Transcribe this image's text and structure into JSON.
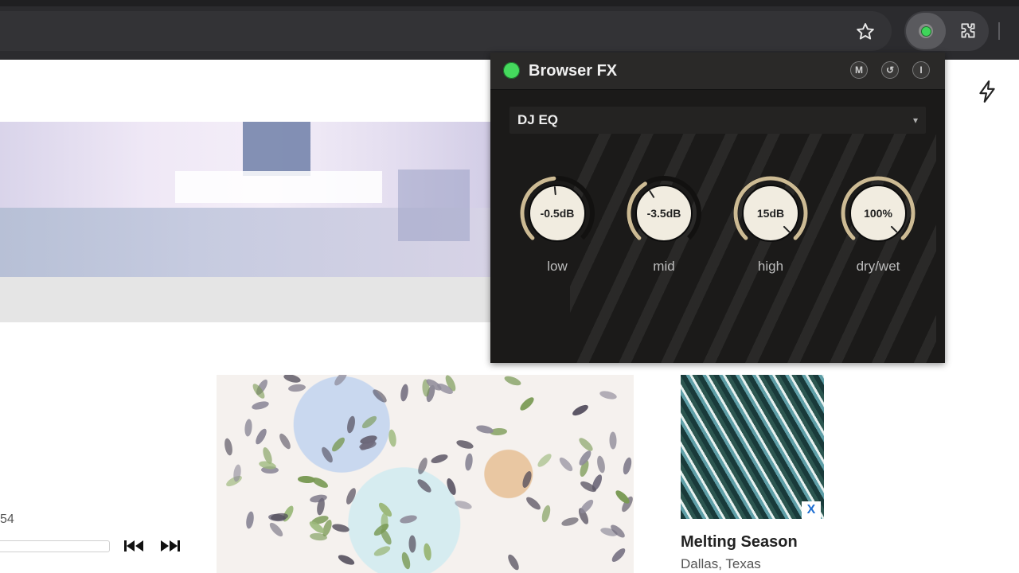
{
  "browser": {
    "star_icon": "star-outline-icon",
    "extension_icon": "browser-fx-extension-icon",
    "puzzle_icon": "puzzle-piece-icon"
  },
  "page": {
    "bolt_icon": "lightning-bolt-icon",
    "player": {
      "time": "54",
      "prev_icon": "skip-previous-icon",
      "next_icon": "skip-next-icon"
    },
    "album": {
      "title": "Melting Season",
      "location": "Dallas, Texas",
      "close_label": "X"
    }
  },
  "fx": {
    "title": "Browser FX",
    "power_color": "#45d95d",
    "header_buttons": [
      "M",
      "↺",
      "I"
    ],
    "preset": "DJ EQ",
    "preset_arrow": "▾",
    "knobs": [
      {
        "label": "low",
        "value": "-0.5dB",
        "level": 0.48
      },
      {
        "label": "mid",
        "value": "-3.5dB",
        "level": 0.38
      },
      {
        "label": "high",
        "value": "15dB",
        "level": 1.0
      },
      {
        "label": "dry/wet",
        "value": "100%",
        "level": 1.0
      }
    ],
    "accent_color": "#cdbb94",
    "knob_face_color": "#f1ece0"
  }
}
